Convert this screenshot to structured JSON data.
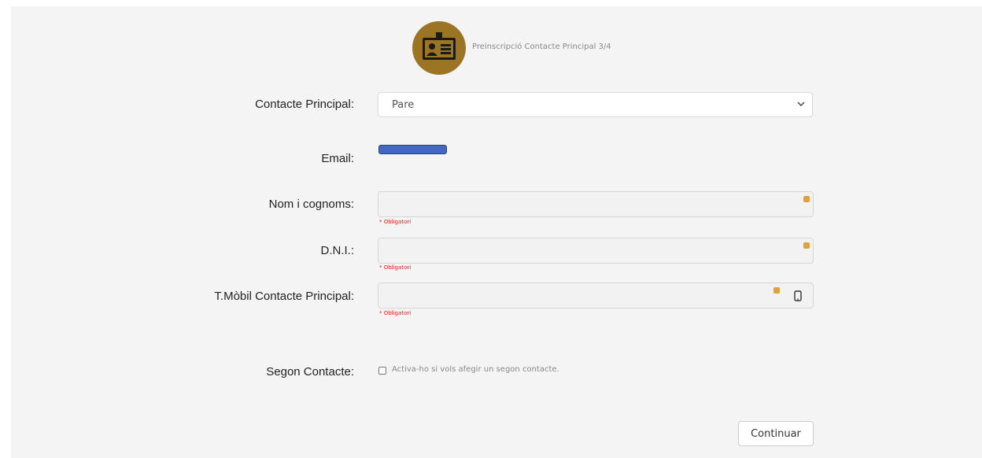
{
  "header": {
    "title": "Preinscripció Contacte Principal 3/4",
    "icon": "id-card-icon",
    "badge_color": "#9b7523"
  },
  "form": {
    "contact": {
      "label": "Contacte Principal:",
      "selected": "Pare"
    },
    "email": {
      "label": "Email:"
    },
    "name": {
      "label": "Nom i cognoms:",
      "hint": "* Obligatori"
    },
    "dni": {
      "label": "D.N.I.:",
      "hint": "* Obligatori"
    },
    "mobile": {
      "label": "T.Mòbil Contacte Principal:",
      "hint": "* Obligatori",
      "addon_icon": "mobile-phone-icon"
    },
    "second": {
      "label": "Segon Contacte:",
      "checkbox_label": "Activa-ho si vols afegir un segon contacte."
    }
  },
  "actions": {
    "continue_label": "Continuar"
  }
}
